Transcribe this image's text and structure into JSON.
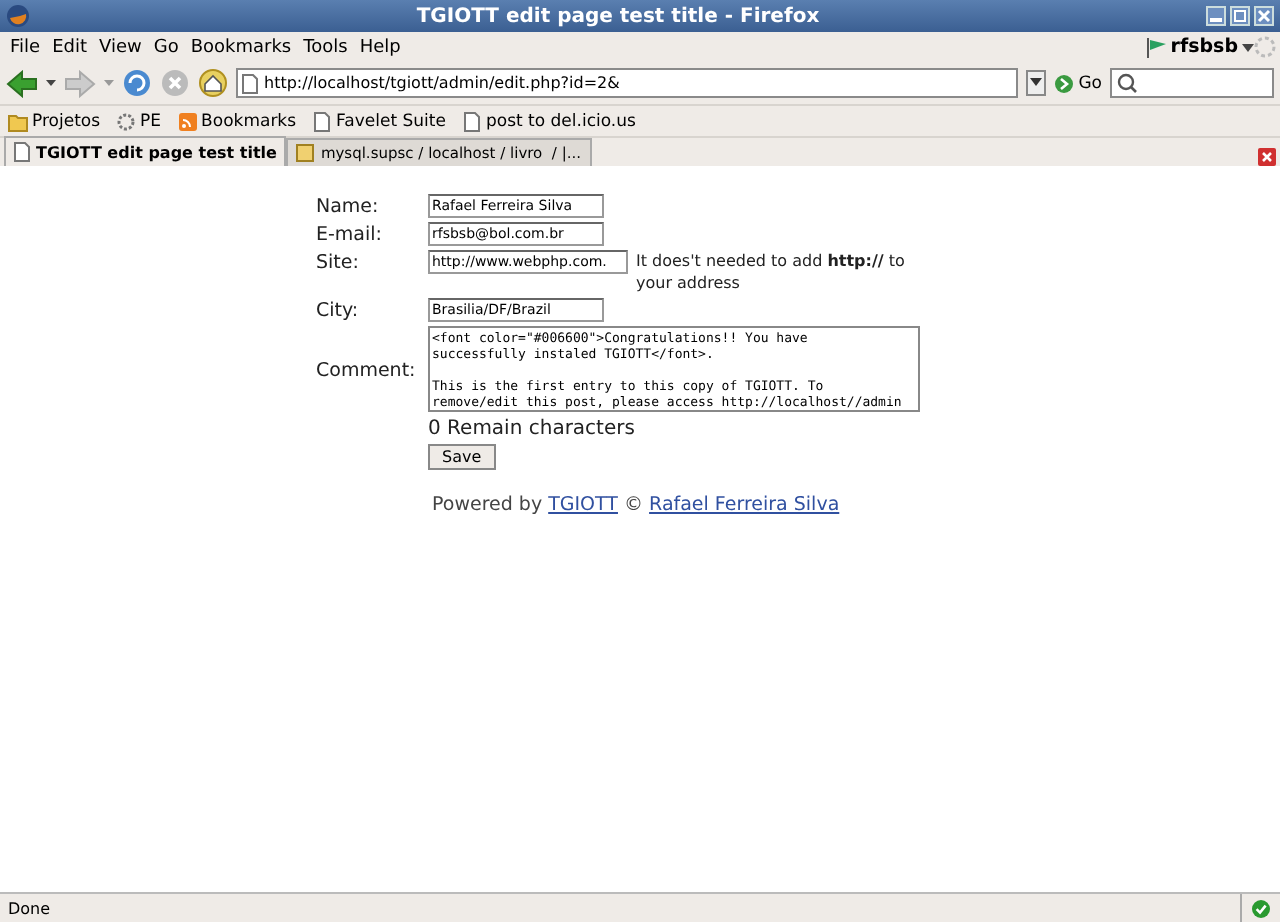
{
  "window": {
    "title": "TGIOTT edit page test title - Firefox"
  },
  "menu": [
    "File",
    "Edit",
    "View",
    "Go",
    "Bookmarks",
    "Tools",
    "Help"
  ],
  "profile": "rfsbsb",
  "address": {
    "value": "http://localhost/tgiott/admin/edit.php?id=2&"
  },
  "go_button": "Go",
  "bookmarks": [
    "Projetos",
    "PE",
    "Bookmarks",
    "Favelet Suite",
    "post to del.icio.us"
  ],
  "tabs": [
    {
      "label": "TGIOTT edit page test title",
      "selected": true
    },
    {
      "label": "mysql.supsc / localhost / livro  / |...",
      "selected": false
    }
  ],
  "form": {
    "fields": [
      {
        "label": "Name:",
        "value": "Rafael Ferreira Silva"
      },
      {
        "label": "E-mail:",
        "value": "rfsbsb@bol.com.br"
      },
      {
        "label": "Site:",
        "value": "http://www.webphp.com.",
        "hint": "It does't needed to add **http://** to your address"
      },
      {
        "label": "City:",
        "value": "Brasilia/DF/Brazil"
      }
    ],
    "comment": {
      "label": "Comment:",
      "value": "<font color=\"#006600\">Congratulations!! You have\nsuccessfully instaled TGIOTT</font>.\n\nThis is the first entry to this copy of TGIOTT. To\nremove/edit this post, please access http://localhost//admin"
    },
    "remain": "0 Remain characters",
    "save": "Save"
  },
  "footer": {
    "prefix": "Powered by",
    "link": "TGIOTT",
    "separator": "©",
    "author": "Rafael Ferreira Silva"
  },
  "status_bar": {
    "text": "Done"
  }
}
